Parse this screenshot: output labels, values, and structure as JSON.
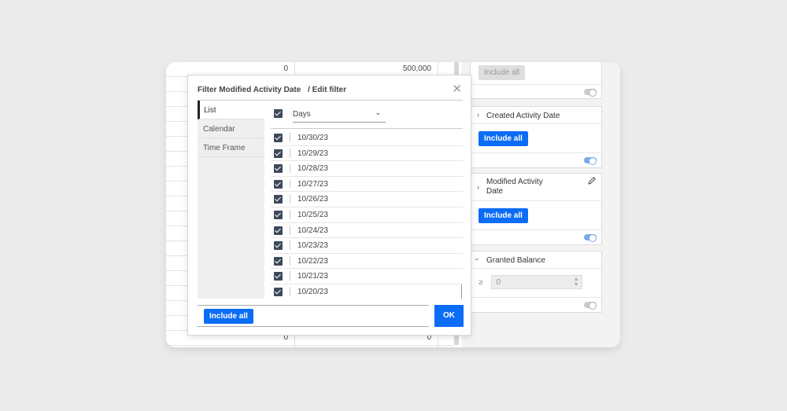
{
  "background_table": {
    "top_values": [
      "0",
      "500,000"
    ],
    "bottom_values": [
      "0",
      "0"
    ]
  },
  "right_panel": {
    "top_card": {
      "include_all": "Include all"
    },
    "cards": [
      {
        "title": "Created Activity Date",
        "include_all": "Include all",
        "toggle_on": true
      },
      {
        "title_line1": "Modified Activity",
        "title_line2": "Date",
        "include_all": "Include all",
        "toggle_on": true,
        "icon": "pencil-icon"
      },
      {
        "title": "Granted Balance",
        "operator": "≥",
        "value": "0",
        "toggle_on": false
      }
    ]
  },
  "modal": {
    "title": "Filter Modified Activity Date",
    "subtitle": "/ Edit filter",
    "close_icon": "close-icon",
    "nav": [
      {
        "label": "List",
        "active": true
      },
      {
        "label": "Calendar",
        "active": false
      },
      {
        "label": "Time Frame",
        "active": false
      }
    ],
    "group_select": "Days",
    "dates": [
      "10/30/23",
      "10/29/23",
      "10/28/23",
      "10/27/23",
      "10/26/23",
      "10/25/23",
      "10/24/23",
      "10/23/23",
      "10/22/23",
      "10/21/23",
      "10/20/23"
    ],
    "include_all": "Include all",
    "ok": "OK"
  },
  "colors": {
    "primary": "#0b6cf5",
    "checkbox": "#3e4a5c",
    "background": "#ebebeb"
  }
}
